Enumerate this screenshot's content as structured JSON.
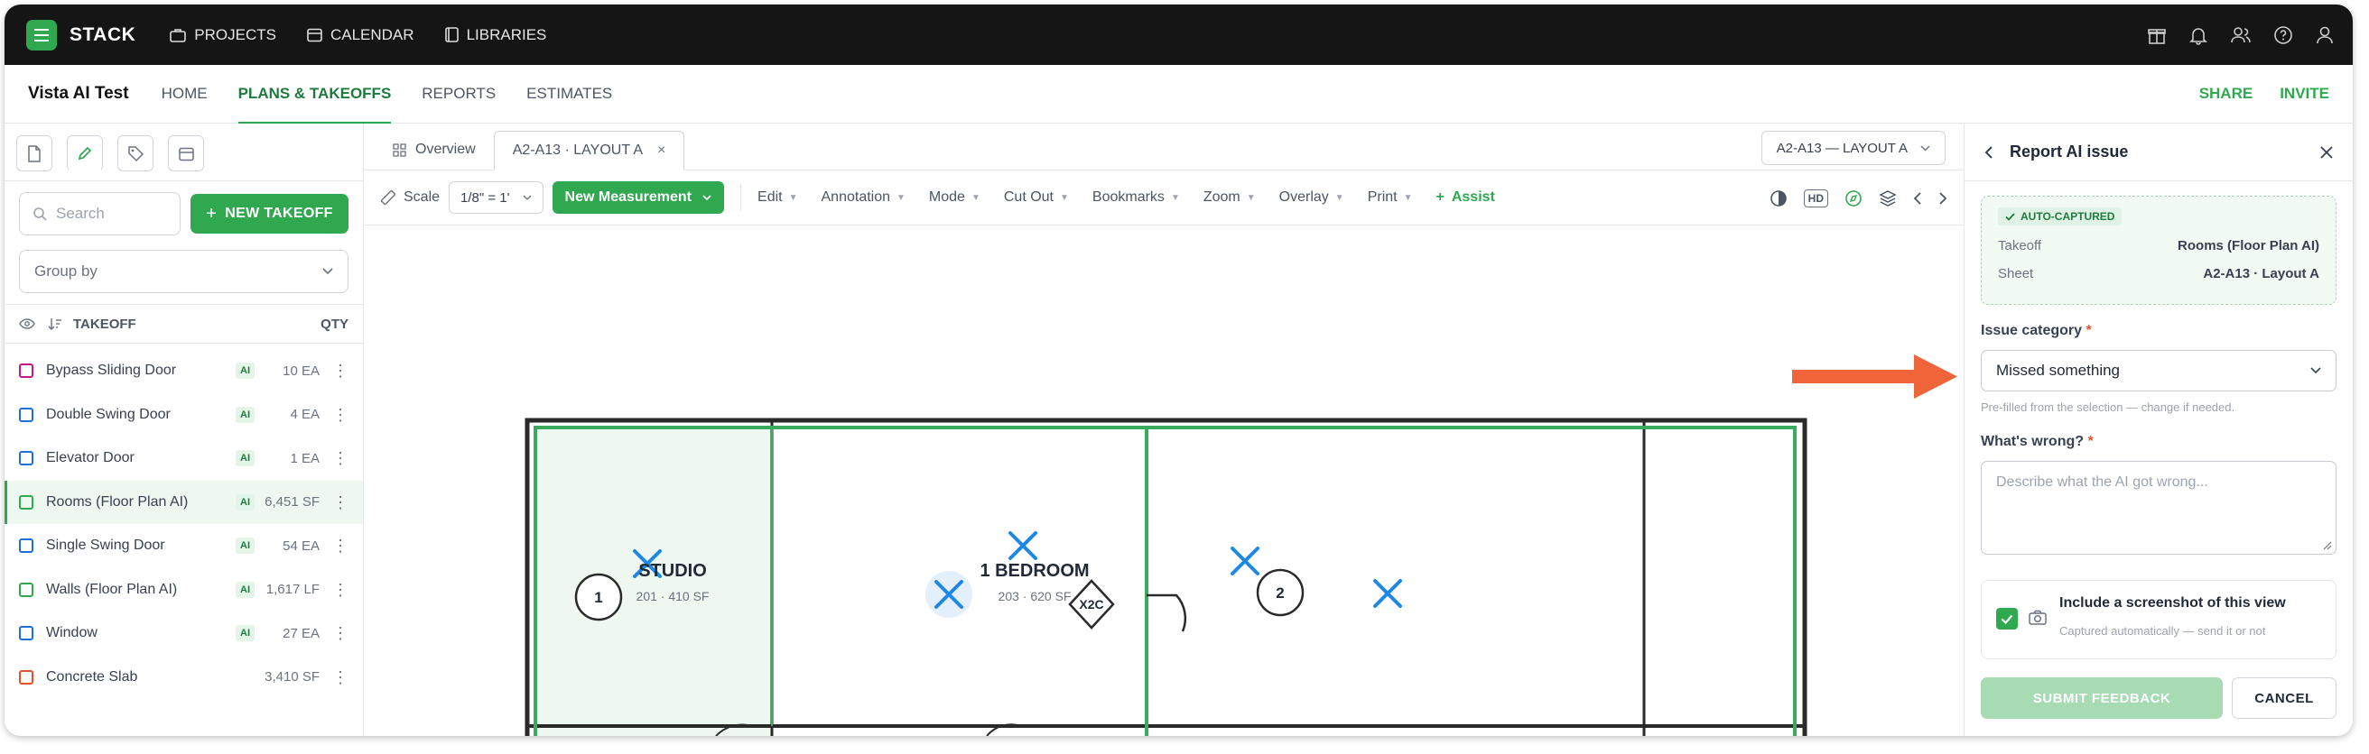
{
  "brand": {
    "name": "STACK",
    "accent": "#2fa84f"
  },
  "topnav": [
    {
      "label": "PROJECTS",
      "icon": "briefcase-icon"
    },
    {
      "label": "CALENDAR",
      "icon": "calendar-icon"
    },
    {
      "label": "LIBRARIES",
      "icon": "book-icon"
    }
  ],
  "top_right_icons": [
    "gift-icon",
    "bell-icon",
    "users-icon",
    "help-icon",
    "user-icon"
  ],
  "project": {
    "name": "Vista AI Test"
  },
  "subnav": {
    "tabs": [
      "HOME",
      "PLANS & TAKEOFFS",
      "REPORTS",
      "ESTIMATES"
    ],
    "active": "PLANS & TAKEOFFS",
    "share_label": "SHARE",
    "invite_label": "INVITE"
  },
  "sidebar": {
    "tabs": [
      "document-icon",
      "pencil-icon",
      "tag-icon",
      "calendar-icon"
    ],
    "search_placeholder": "Search",
    "new_takeoff_label": "NEW TAKEOFF",
    "group_by_placeholder": "Group by",
    "header": {
      "takeoff": "TAKEOFF",
      "qty": "QTY"
    },
    "items": [
      {
        "name": "Bypass Sliding Door",
        "ai": true,
        "qty": "10 EA",
        "color": "#c2188a"
      },
      {
        "name": "Double Swing Door",
        "ai": true,
        "qty": "4 EA",
        "color": "#1e6fd9"
      },
      {
        "name": "Elevator Door",
        "ai": true,
        "qty": "1 EA",
        "color": "#1e6fd9"
      },
      {
        "name": "Rooms (Floor Plan AI)",
        "ai": true,
        "qty": "6,451 SF",
        "color": "#2fa84f",
        "selected": true
      },
      {
        "name": "Single Swing Door",
        "ai": true,
        "qty": "54 EA",
        "color": "#1e6fd9"
      },
      {
        "name": "Walls (Floor Plan AI)",
        "ai": true,
        "qty": "1,617 LF",
        "color": "#2fa84f"
      },
      {
        "name": "Window",
        "ai": true,
        "qty": "27 EA",
        "color": "#1e6fd9"
      },
      {
        "name": "Concrete Slab",
        "ai": false,
        "qty": "3,410 SF",
        "color": "#e0522b"
      }
    ],
    "ai_label": "AI"
  },
  "sheets": {
    "overview_label": "Overview",
    "active_tab": "A2-A13 · LAYOUT A",
    "selector": "A2-A13 — LAYOUT A"
  },
  "toolbar": {
    "scale_label": "Scale",
    "scale_value": "1/8\" = 1'",
    "new_measurement": "New Measurement",
    "menus": [
      "Edit",
      "Annotation",
      "Mode",
      "Cut Out",
      "Bookmarks",
      "Zoom",
      "Overlay",
      "Print"
    ],
    "assist": "Assist",
    "hd": "HD"
  },
  "plan": {
    "rooms": [
      {
        "name": "STUDIO",
        "sub": "201 · 410 SF"
      },
      {
        "name": "1 BEDROOM",
        "sub": "203 · 620 SF"
      }
    ],
    "tags": [
      "1",
      "2"
    ],
    "door_tag": "X2C"
  },
  "panel": {
    "title": "Report AI issue",
    "autocaptured_label": "AUTO-CAPTURED",
    "takeoff_key": "Takeoff",
    "takeoff_value": "Rooms (Floor Plan AI)",
    "sheet_key": "Sheet",
    "sheet_value": "A2-A13 · Layout A",
    "category_label": "Issue category",
    "category_value": "Missed something",
    "category_hint": "Pre-filled from the selection — change if needed.",
    "wrong_label": "What's wrong?",
    "wrong_placeholder": "Describe what the AI got wrong...",
    "screenshot_title": "Include a screenshot of this view",
    "screenshot_sub": "Captured automatically — send it or not",
    "screenshot_checked": true,
    "submit_label": "SUBMIT FEEDBACK",
    "cancel_label": "CANCEL",
    "required_mark": "*"
  },
  "colors": {
    "arrow": "#f0643a",
    "plan_green": "#3aaa5f",
    "marker_blue": "#1e88e5"
  }
}
